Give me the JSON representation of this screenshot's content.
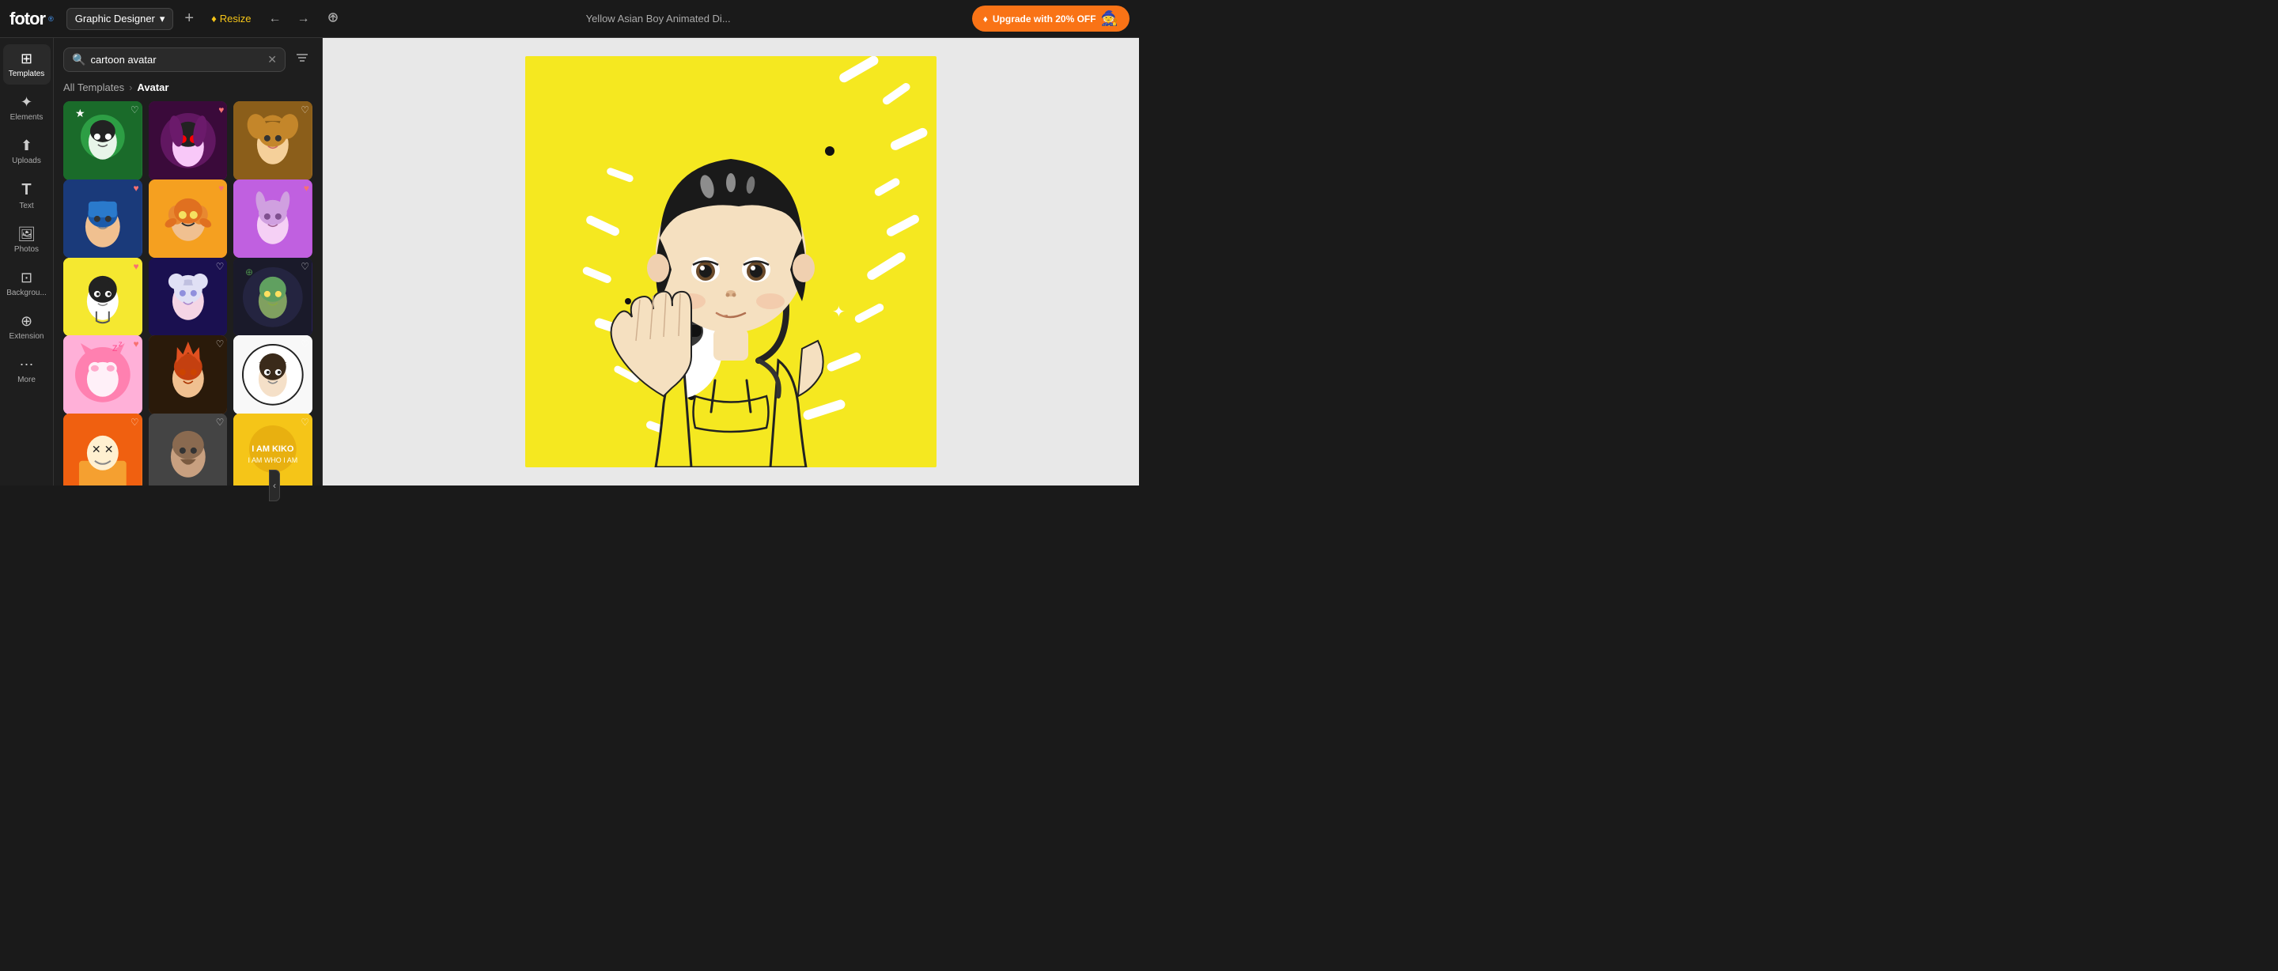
{
  "app": {
    "logo": "fotor",
    "logo_superscript": "®"
  },
  "topbar": {
    "designer_label": "Graphic Designer",
    "add_label": "+",
    "resize_label": "Resize",
    "doc_title": "Yellow Asian Boy Animated Di...",
    "upgrade_label": "Upgrade with 20% OFF",
    "back_icon": "←",
    "forward_icon": "→",
    "upload_icon": "↑"
  },
  "sidebar": {
    "items": [
      {
        "id": "templates",
        "icon": "⊞",
        "label": "Templates",
        "active": true
      },
      {
        "id": "elements",
        "icon": "✦",
        "label": "Elements",
        "active": false
      },
      {
        "id": "uploads",
        "icon": "⬆",
        "label": "Uploads",
        "active": false
      },
      {
        "id": "text",
        "icon": "T",
        "label": "Text",
        "active": false
      },
      {
        "id": "photos",
        "icon": "🖼",
        "label": "Photos",
        "active": false
      },
      {
        "id": "backgrounds",
        "icon": "⊡",
        "label": "Backgrou...",
        "active": false
      },
      {
        "id": "extension",
        "icon": "⊕",
        "label": "Extension",
        "active": false
      },
      {
        "id": "more",
        "icon": "⋯",
        "label": "More",
        "active": false
      }
    ]
  },
  "panel": {
    "search_placeholder": "cartoon avatar",
    "search_value": "cartoon avatar",
    "breadcrumb_all": "All Templates",
    "breadcrumb_current": "Avatar",
    "filter_icon": "⊟"
  },
  "grid": {
    "items": [
      {
        "id": 1,
        "class": "avatar-1",
        "liked": false
      },
      {
        "id": 2,
        "class": "avatar-2",
        "liked": true
      },
      {
        "id": 3,
        "class": "avatar-3",
        "liked": false
      },
      {
        "id": 4,
        "class": "avatar-4",
        "liked": true
      },
      {
        "id": 5,
        "class": "avatar-5",
        "liked": true
      },
      {
        "id": 6,
        "class": "avatar-6",
        "liked": true
      },
      {
        "id": 7,
        "class": "avatar-7",
        "liked": true
      },
      {
        "id": 8,
        "class": "avatar-8",
        "liked": false
      },
      {
        "id": 9,
        "class": "avatar-9",
        "liked": false
      },
      {
        "id": 10,
        "class": "avatar-10",
        "liked": true
      },
      {
        "id": 11,
        "class": "avatar-11",
        "liked": false
      },
      {
        "id": 12,
        "class": "avatar-12",
        "liked": false
      },
      {
        "id": 13,
        "class": "avatar-13",
        "liked": false
      },
      {
        "id": 14,
        "class": "avatar-14",
        "liked": false
      },
      {
        "id": 15,
        "class": "avatar-15",
        "liked": false
      }
    ]
  },
  "canvas": {
    "background_color": "#e8e8e8",
    "artwork_background": "#f5e820"
  },
  "colors": {
    "accent_orange": "#f97316",
    "topbar_bg": "#1a1a1a",
    "panel_bg": "#1e1e1e",
    "upgrade_bg": "#f97316"
  }
}
